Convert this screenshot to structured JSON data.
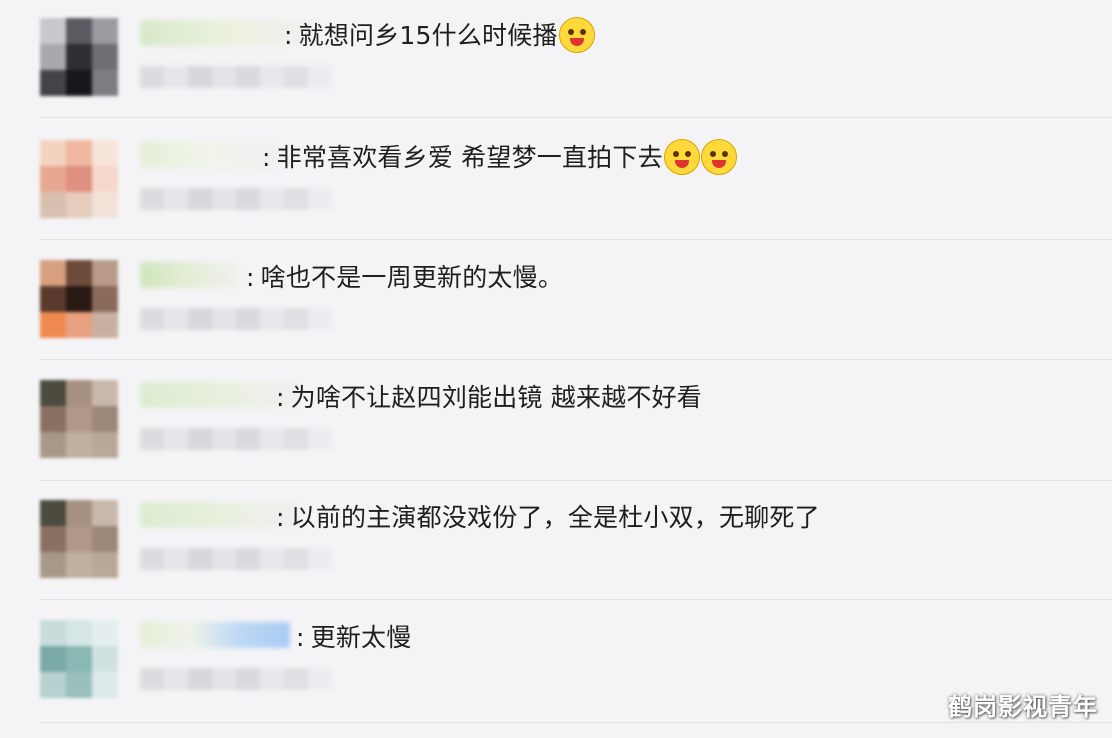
{
  "colon": ":",
  "comments": [
    {
      "text": "就想问乡15什么时候播",
      "emoji_count": 1
    },
    {
      "text": "非常喜欢看乡爱 希望梦一直拍下去",
      "emoji_count": 2
    },
    {
      "text": "啥也不是一周更新的太慢。",
      "emoji_count": 0
    },
    {
      "text": "为啥不让赵四刘能出镜 越来越不好看",
      "emoji_count": 0
    },
    {
      "text": "以前的主演都没戏份了，全是杜小双，无聊死了",
      "emoji_count": 0
    },
    {
      "text": "更新太慢",
      "emoji_count": 0
    }
  ],
  "watermark": "鹤岗影视青年",
  "colors": {
    "background": "#f4f4f6",
    "text": "#1e1e1e",
    "divider": "#e2e2e6",
    "emoji": "#ffd93a"
  },
  "icons": {
    "emoji": "laughing-face-icon"
  }
}
